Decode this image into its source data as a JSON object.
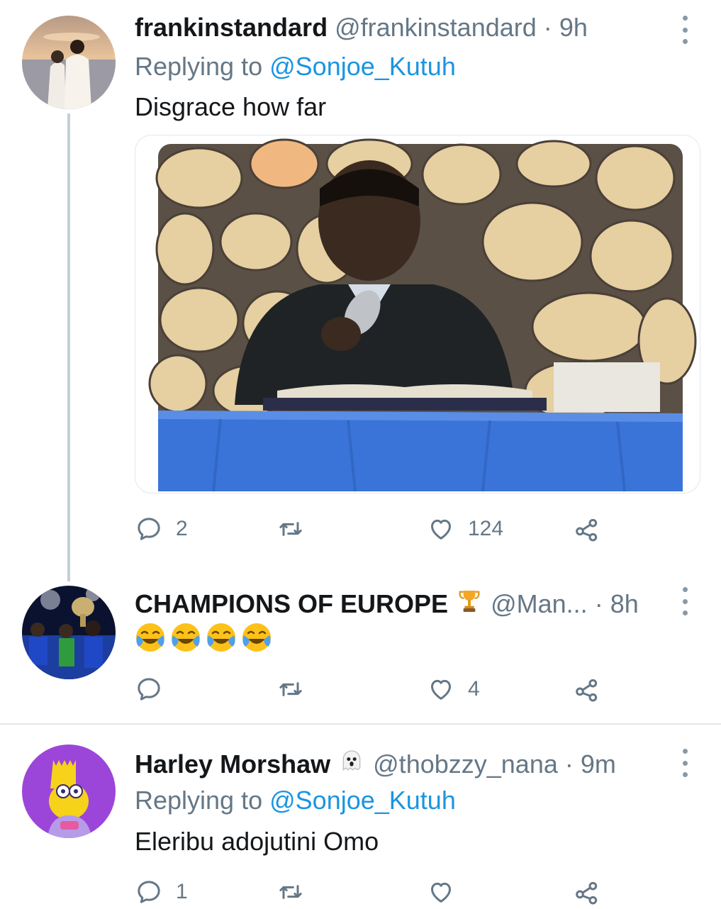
{
  "tweets": [
    {
      "name": "frankinstandard",
      "handle": "@frankinstandard",
      "dot": "·",
      "time": "9h",
      "replying_prefix": "Replying to ",
      "replying_to": "@Sonjoe_Kutuh",
      "text": "Disgrace how far",
      "replies": "2",
      "likes": "124"
    },
    {
      "name": "CHAMPIONS OF EUROPE",
      "badge_icon": "trophy-emoji",
      "handle": "@Man...",
      "dot": "·",
      "time": "8h",
      "text": "😂😂😂😂",
      "likes": "4"
    },
    {
      "name": "Harley Morshaw",
      "badge_icon": "ghost-emoji",
      "handle": "@thobzzy_nana",
      "dot": "·",
      "time": "9m",
      "replying_prefix": "Replying to ",
      "replying_to": "@Sonjoe_Kutuh",
      "text": "Eleribu adojutini Omo",
      "replies": "1"
    }
  ],
  "colors": {
    "primary_text": "#14171a",
    "secondary_text": "#657786",
    "link": "#1b95e0",
    "divider": "#e1e8ed"
  }
}
